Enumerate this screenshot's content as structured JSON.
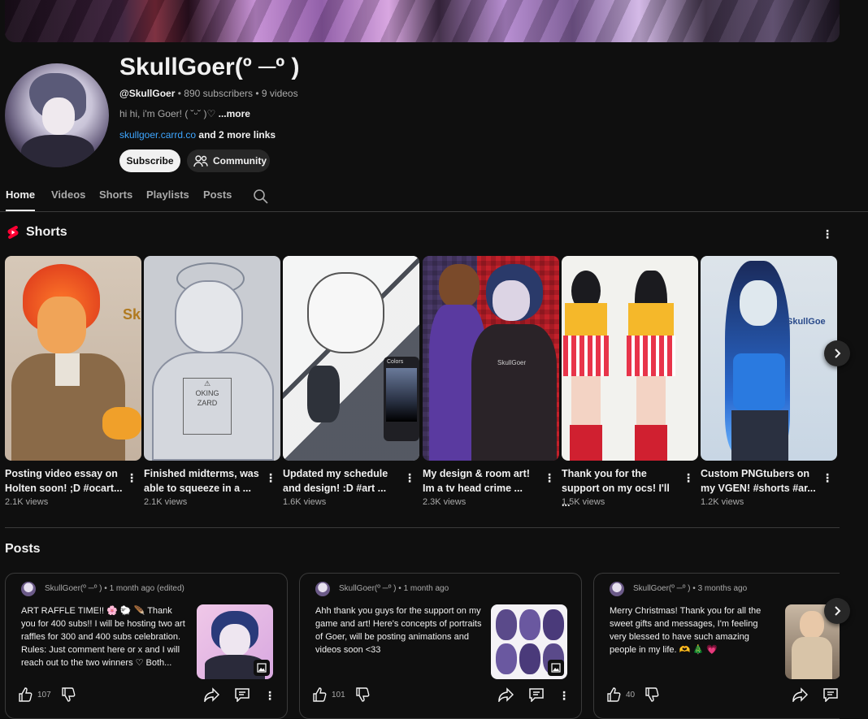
{
  "channel": {
    "name": "SkullGoer(º ─º )",
    "handle": "@SkullGoer",
    "subscribers": "890 subscribers",
    "videos": "9 videos",
    "description": "hi hi, i'm Goer! ( ˘ᵕ˘ )♡",
    "more": "...more",
    "link": "skullgoer.carrd.co",
    "more_links": "and 2 more links",
    "subscribe_label": "Subscribe",
    "community_label": "Community"
  },
  "tabs": [
    "Home",
    "Videos",
    "Shorts",
    "Playlists",
    "Posts"
  ],
  "shorts": {
    "heading": "Shorts",
    "items": [
      {
        "title": "Posting video essay on Holten soon! ;D #ocart...",
        "views": "2.1K views"
      },
      {
        "title": "Finished midterms, was able to squeeze in a ...",
        "views": "2.1K views"
      },
      {
        "title": "Updated my schedule and design! :D #art ...",
        "views": "1.6K views"
      },
      {
        "title": "My design & room art! Im a tv head crime ...",
        "views": "2.3K views"
      },
      {
        "title": "Thank you for the support on my ocs! I'll ...",
        "views": "1.5K views"
      },
      {
        "title": "Custom PNGtubers on my VGEN! #shorts #ar...",
        "views": "1.2K views"
      }
    ]
  },
  "posts": {
    "heading": "Posts",
    "items": [
      {
        "author": "SkullGoer(º ─º )",
        "time": "1 month ago (edited)",
        "text": "ART RAFFLE TIME!! 🌸 🐑 🪶 Thank you for 400 subs!! I will be hosting two art raffles for 300 and 400 subs celebration. Rules: Just comment here or x and I will reach out to the two winners ♡ Both...",
        "likes": "107"
      },
      {
        "author": "SkullGoer(º ─º )",
        "time": "1 month ago",
        "text": "Ahh thank you guys for the support on my game and art! Here's concepts of portraits of Goer, will be posting animations and videos soon <33",
        "likes": "101"
      },
      {
        "author": "SkullGoer(º ─º )",
        "time": "3 months ago",
        "text": "Merry Christmas! Thank you for all the sweet gifts and messages, I'm feeling very blessed to have such amazing people in my life. 🫶 🎄 💗",
        "likes": "40"
      }
    ]
  },
  "thumb_texts": {
    "s1": "Sk",
    "s6": "SkullGoe",
    "s4": "SkullGoer",
    "s3_panel": "Colors"
  },
  "colors": {
    "background": "#0f0f0f",
    "text": "#f1f1f1",
    "secondary_text": "#aaaaaa",
    "link": "#3ea6ff",
    "shorts_red": "#ff0033"
  }
}
